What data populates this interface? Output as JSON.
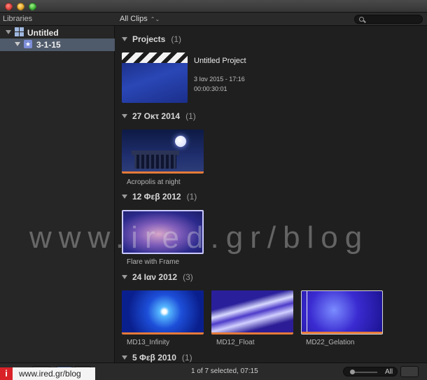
{
  "window": {
    "controls": [
      "close",
      "minimize",
      "zoom"
    ]
  },
  "toolbar": {
    "libraries_header": "Libraries",
    "clips_filter": "All Clips",
    "clips_filter_arrows": "⌃⌄",
    "search_placeholder": ""
  },
  "sidebar": {
    "library": {
      "name": "Untitled",
      "icon": "library-grid-icon"
    },
    "event": {
      "name": "3-1-15",
      "icon": "star-event-icon",
      "selected": true
    }
  },
  "browser": {
    "sections": [
      {
        "title": "Projects",
        "count": "(1)"
      },
      {
        "title": "27 Οκτ 2014",
        "count": "(1)"
      },
      {
        "title": "12 Φεβ 2012",
        "count": "(1)"
      },
      {
        "title": "24 Ιαν 2012",
        "count": "(3)"
      },
      {
        "title": "5 Φεβ 2010",
        "count": "(1)"
      }
    ],
    "project": {
      "title": "Untitled Project",
      "date": "3 Ιαν 2015 - 17:16",
      "duration": "00:00:30:01"
    },
    "clips": [
      {
        "label": "Acropolis at night"
      },
      {
        "label": "Flare with Frame"
      },
      {
        "label": "MD13_Infinity"
      },
      {
        "label": "MD12_Float"
      },
      {
        "label": "MD22_Gelation"
      }
    ],
    "watermark": "www.ired.gr/blog"
  },
  "bottombar": {
    "status": "1 of 7 selected, 07:15",
    "zoom_label": "All",
    "site_logo": "i",
    "site_text": "www.ired.gr/blog"
  },
  "colors": {
    "accent": "#e57a3a",
    "selection": "#4f5a6a",
    "background": "#1f1f1f"
  }
}
